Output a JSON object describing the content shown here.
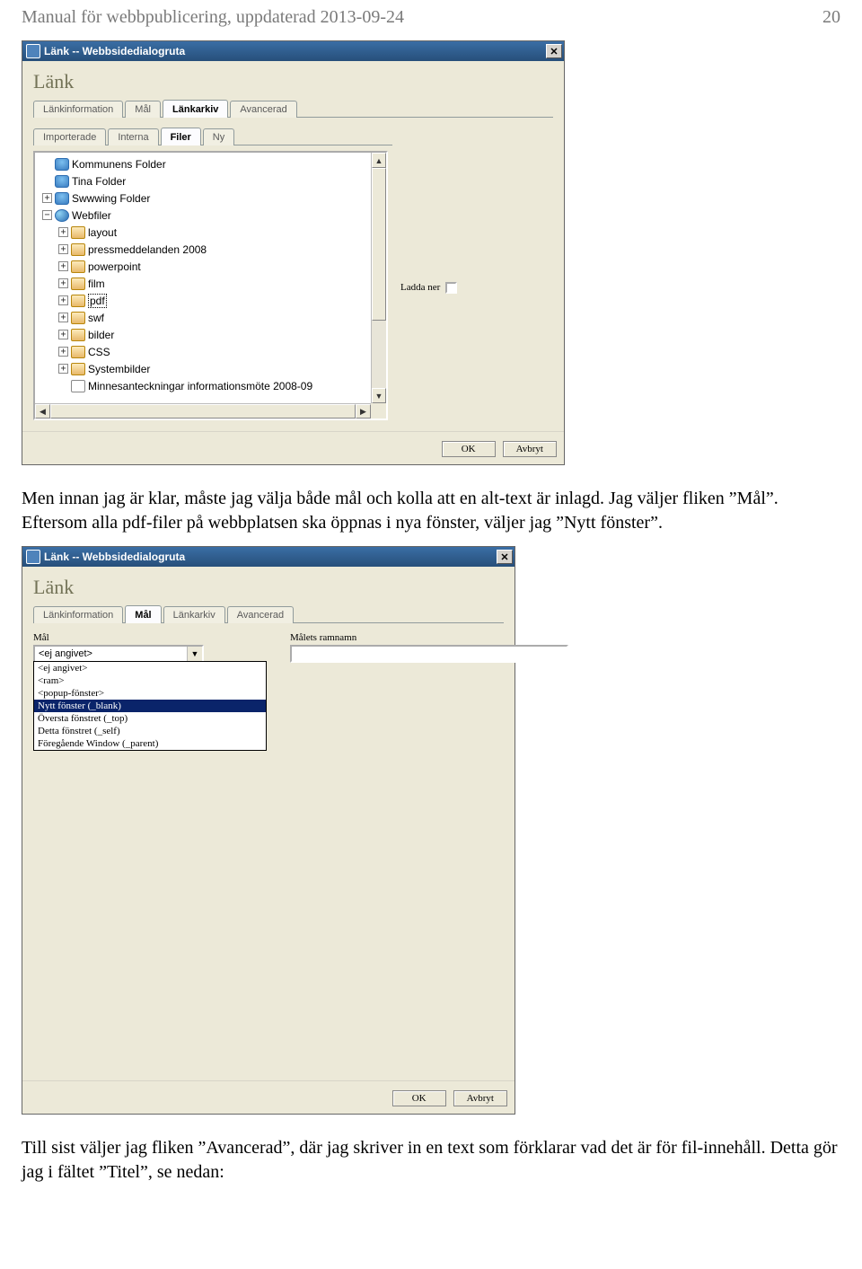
{
  "header": {
    "left": "Manual för webbpublicering, uppdaterad 2013-09-24",
    "right": "20"
  },
  "dlg1": {
    "window_title": "Länk -- Webbsidedialogruta",
    "title": "Länk",
    "tabs_upper": [
      "Länkinformation",
      "Mål",
      "Länkarkiv",
      "Avancerad"
    ],
    "tabs_upper_active": 2,
    "tabs_lower": [
      "Importerade",
      "Interna",
      "Filer",
      "Ny"
    ],
    "tabs_lower_active": 2,
    "right_opt_label": "Ladda ner",
    "tree": [
      {
        "indent": 0,
        "exp": "",
        "iconType": "user",
        "label": "Kommunens Folder"
      },
      {
        "indent": 0,
        "exp": "",
        "iconType": "user",
        "label": "Tina Folder"
      },
      {
        "indent": 0,
        "exp": "+",
        "iconType": "user",
        "label": "Swwwing Folder"
      },
      {
        "indent": 0,
        "exp": "−",
        "iconType": "globe",
        "label": "Webfiler"
      },
      {
        "indent": 1,
        "exp": "+",
        "iconType": "folder",
        "label": "layout"
      },
      {
        "indent": 1,
        "exp": "+",
        "iconType": "folder",
        "label": "pressmeddelanden 2008"
      },
      {
        "indent": 1,
        "exp": "+",
        "iconType": "folder",
        "label": "powerpoint"
      },
      {
        "indent": 1,
        "exp": "+",
        "iconType": "folder",
        "label": "film"
      },
      {
        "indent": 1,
        "exp": "+",
        "iconType": "folder",
        "label": "pdf",
        "selected": true
      },
      {
        "indent": 1,
        "exp": "+",
        "iconType": "folder",
        "label": "swf"
      },
      {
        "indent": 1,
        "exp": "+",
        "iconType": "folder",
        "label": "bilder"
      },
      {
        "indent": 1,
        "exp": "+",
        "iconType": "folder",
        "label": "CSS"
      },
      {
        "indent": 1,
        "exp": "+",
        "iconType": "folder",
        "label": "Systembilder"
      },
      {
        "indent": 1,
        "exp": "",
        "iconType": "doc",
        "label": "Minnesanteckningar informationsmöte 2008-09"
      }
    ],
    "ok": "OK",
    "cancel": "Avbryt"
  },
  "para1": "Men innan jag är klar, måste jag välja både mål och kolla att en alt-text är inlagd. Jag väljer fliken ”Mål”. Eftersom alla pdf-filer på webbplatsen ska öppnas i nya fönster, väljer jag ”Nytt fönster”.",
  "dlg2": {
    "window_title": "Länk -- Webbsidedialogruta",
    "title": "Länk",
    "tabs_upper": [
      "Länkinformation",
      "Mål",
      "Länkarkiv",
      "Avancerad"
    ],
    "tabs_upper_active": 1,
    "label_mal": "Mål",
    "label_ramnamn": "Målets ramnamn",
    "select_value": "<ej angivet>",
    "list": [
      {
        "label": "<ej angivet>"
      },
      {
        "label": "<ram>"
      },
      {
        "label": "<popup-fönster>"
      },
      {
        "label": "Nytt fönster (_blank)",
        "selected": true
      },
      {
        "label": "Översta fönstret (_top)"
      },
      {
        "label": "Detta fönstret (_self)"
      },
      {
        "label": "Föregående Window (_parent)"
      }
    ],
    "ok": "OK",
    "cancel": "Avbryt"
  },
  "para2": "Till sist väljer jag fliken ”Avancerad”, där jag skriver in en text som förklarar vad det är för fil-innehåll. Detta gör jag i fältet ”Titel”, se nedan:"
}
